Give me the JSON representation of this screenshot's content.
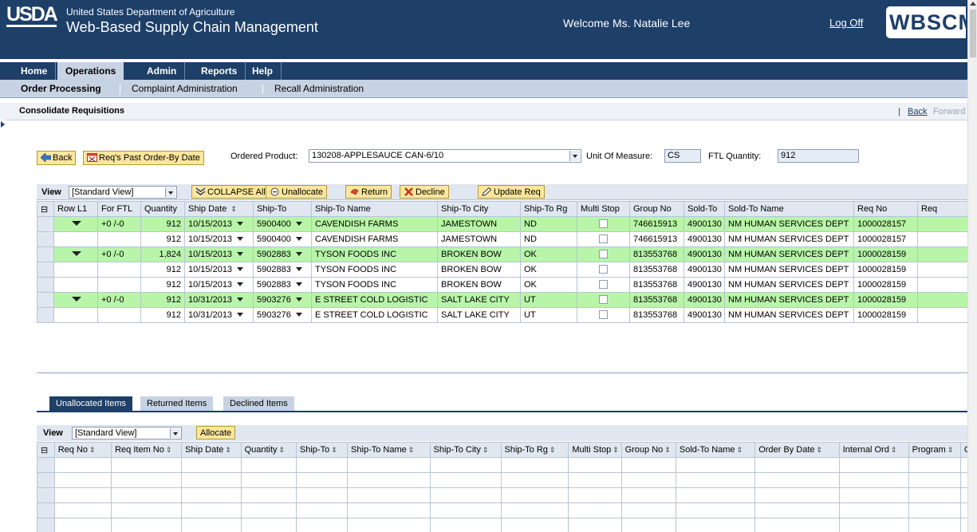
{
  "header": {
    "logo": "USDA",
    "dept": "United States Department of Agriculture",
    "app": "Web-Based Supply Chain Management",
    "welcome": "Welcome Ms. Natalie Lee",
    "logoff": "Log Off",
    "brand": "WBSCM"
  },
  "menu": [
    "Home",
    "Operations",
    "Admin",
    "Reports",
    "Help"
  ],
  "submenu": [
    "Order Processing",
    "Complaint Administration",
    "Recall Administration"
  ],
  "page": {
    "title": "Consolidate Requisitions",
    "back": "Back",
    "forward": "Forward"
  },
  "filters": {
    "back_btn": "Back",
    "reqs_btn": "Req's Past Order-By Date",
    "product_label": "Ordered Product:",
    "product_value": "130208-APPLESAUCE CAN-6/10",
    "uom_label": "Unit Of Measure:",
    "uom_value": "CS",
    "ftl_label": "FTL Quantity:",
    "ftl_value": "912"
  },
  "toolbar1": {
    "view_label": "View",
    "view_value": "[Standard View]",
    "collapse": "COLLAPSE All",
    "unallocate": "Unallocate",
    "return": "Return",
    "decline": "Decline",
    "update": "Update Req"
  },
  "grid1": {
    "columns": [
      "Row L1",
      "For FTL",
      "Quantity",
      "Ship Date",
      "Ship-To",
      "Ship-To Name",
      "Ship-To City",
      "Ship-To Rg",
      "Multi Stop",
      "Group No",
      "Sold-To",
      "Sold-To Name",
      "Req No",
      "Req"
    ],
    "rows": [
      {
        "group": true,
        "for_ftl": "+0 /-0",
        "qty": "912",
        "date": "10/15/2013",
        "shipto": "5900400",
        "name": "CAVENDISH FARMS",
        "city": "JAMESTOWN",
        "rg": "ND",
        "group_no": "746615913",
        "soldto": "4900130",
        "soldname": "NM HUMAN SERVICES DEPT",
        "req": "1000028157"
      },
      {
        "group": false,
        "for_ftl": "",
        "qty": "912",
        "date": "10/15/2013",
        "shipto": "5900400",
        "name": "CAVENDISH FARMS",
        "city": "JAMESTOWN",
        "rg": "ND",
        "group_no": "746615913",
        "soldto": "4900130",
        "soldname": "NM HUMAN SERVICES DEPT",
        "req": "1000028157"
      },
      {
        "group": true,
        "for_ftl": "+0 /-0",
        "qty": "1,824",
        "date": "10/15/2013",
        "shipto": "5902883",
        "name": "TYSON FOODS INC",
        "city": "BROKEN BOW",
        "rg": "OK",
        "group_no": "813553768",
        "soldto": "4900130",
        "soldname": "NM HUMAN SERVICES DEPT",
        "req": "1000028159"
      },
      {
        "group": false,
        "for_ftl": "",
        "qty": "912",
        "date": "10/15/2013",
        "shipto": "5902883",
        "name": "TYSON FOODS INC",
        "city": "BROKEN BOW",
        "rg": "OK",
        "group_no": "813553768",
        "soldto": "4900130",
        "soldname": "NM HUMAN SERVICES DEPT",
        "req": "1000028159"
      },
      {
        "group": false,
        "for_ftl": "",
        "qty": "912",
        "date": "10/15/2013",
        "shipto": "5902883",
        "name": "TYSON FOODS INC",
        "city": "BROKEN BOW",
        "rg": "OK",
        "group_no": "813553768",
        "soldto": "4900130",
        "soldname": "NM HUMAN SERVICES DEPT",
        "req": "1000028159"
      },
      {
        "group": true,
        "for_ftl": "+0 /-0",
        "qty": "912",
        "date": "10/31/2013",
        "shipto": "5903276",
        "name": "E STREET COLD LOGISTIC",
        "city": "SALT LAKE CITY",
        "rg": "UT",
        "group_no": "813553768",
        "soldto": "4900130",
        "soldname": "NM HUMAN SERVICES DEPT",
        "req": "1000028159"
      },
      {
        "group": false,
        "for_ftl": "",
        "qty": "912",
        "date": "10/31/2013",
        "shipto": "5903276",
        "name": "E STREET COLD LOGISTIC",
        "city": "SALT LAKE CITY",
        "rg": "UT",
        "group_no": "813553768",
        "soldto": "4900130",
        "soldname": "NM HUMAN SERVICES DEPT",
        "req": "1000028159"
      }
    ]
  },
  "tabs": [
    "Unallocated Items",
    "Returned Items",
    "Declined Items"
  ],
  "toolbar2": {
    "view_label": "View",
    "view_value": "[Standard View]",
    "allocate": "Allocate"
  },
  "grid2": {
    "columns": [
      "Req No",
      "Req Item No",
      "Ship Date",
      "Quantity",
      "Ship-To",
      "Ship-To Name",
      "Ship-To City",
      "Ship-To Rg",
      "Multi Stop",
      "Group No",
      "Sold-To Name",
      "Order By Date",
      "Internal Ord",
      "Program",
      "Cus"
    ]
  },
  "colors": {
    "header": "#1d3f68",
    "group_row": "#b8f5a8",
    "button": "#fbe69c"
  }
}
